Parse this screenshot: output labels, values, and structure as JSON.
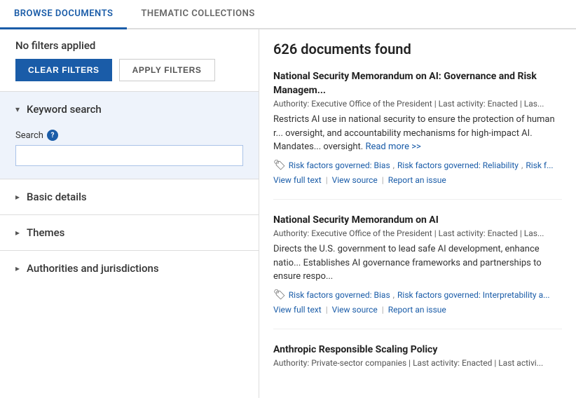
{
  "tabs": [
    {
      "id": "browse",
      "label": "Browse Documents",
      "active": true
    },
    {
      "id": "thematic",
      "label": "Thematic Collections",
      "active": false
    }
  ],
  "sidebar": {
    "filter_status": "No filters applied",
    "clear_label": "CLEAR FILTERS",
    "apply_label": "APPLY FILTERS",
    "sections": [
      {
        "id": "keyword",
        "label": "Keyword search",
        "expanded": true,
        "search_label": "Search",
        "search_placeholder": ""
      },
      {
        "id": "basic",
        "label": "Basic details",
        "expanded": false
      },
      {
        "id": "themes",
        "label": "Themes",
        "expanded": false
      },
      {
        "id": "authorities",
        "label": "Authorities and jurisdictions",
        "expanded": false
      }
    ]
  },
  "results": {
    "count": "626 documents found",
    "items": [
      {
        "title": "National Security Memorandum on AI: Governance and Risk Managem...",
        "meta": "Authority: Executive Office of the President | Last activity: Enacted | Las...",
        "desc": "Restricts AI use in national security to ensure the protection of human r... oversight, and accountability mechanisms for high-impact AI. Mandates... oversight.",
        "read_more": "Read more >>",
        "tags": [
          "Risk factors governed: Bias",
          "Risk factors governed: Reliability",
          "Risk f..."
        ],
        "actions": [
          "View full text",
          "View source",
          "Report an issue"
        ]
      },
      {
        "title": "National Security Memorandum on AI",
        "meta": "Authority: Executive Office of the President | Last activity: Enacted | Las...",
        "desc": "Directs the U.S. government to lead safe AI development, enhance natio... Establishes AI governance frameworks and partnerships to ensure respo...",
        "read_more": null,
        "tags": [
          "Risk factors governed: Bias",
          "Risk factors governed: Interpretability a..."
        ],
        "actions": [
          "View full text",
          "View source",
          "Report an issue"
        ]
      },
      {
        "title": "Anthropic Responsible Scaling Policy",
        "meta": "Authority: Private-sector companies | Last activity: Enacted | Last activi...",
        "desc": "",
        "read_more": null,
        "tags": [],
        "actions": []
      }
    ]
  }
}
